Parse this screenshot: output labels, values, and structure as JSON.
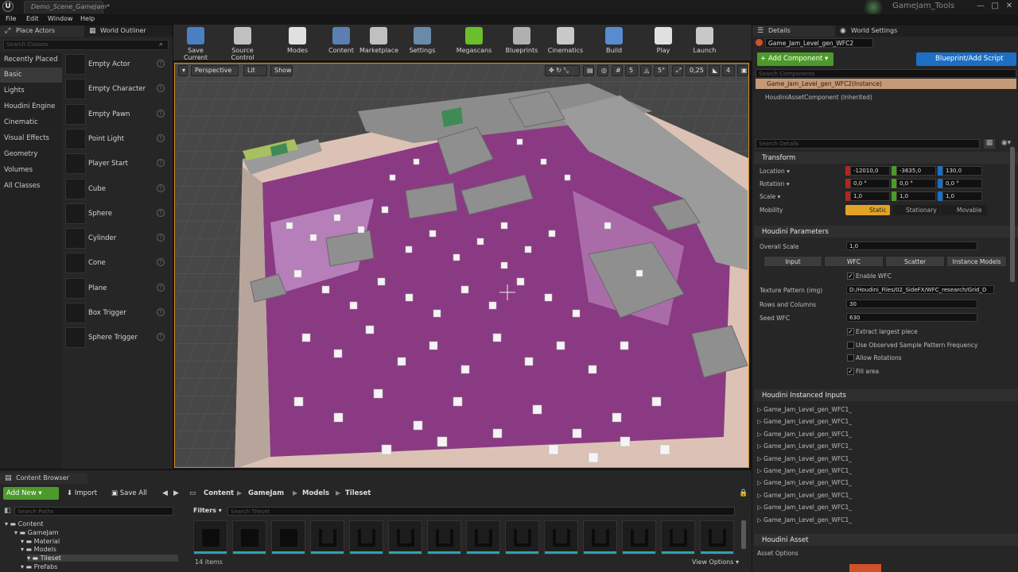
{
  "window": {
    "doc_tab": "Demo_Scene_GameJam*",
    "project_name": "GameJam_Tools",
    "controls": [
      "—",
      "□",
      "✕"
    ]
  },
  "menu": [
    "File",
    "Edit",
    "Window",
    "Help"
  ],
  "left_tabs": {
    "place_actors": "Place Actors",
    "world_outliner": "World Outliner"
  },
  "search_classes_placeholder": "Search Classes",
  "categories": [
    "Recently Placed",
    "Basic",
    "Lights",
    "Houdini Engine",
    "Cinematic",
    "Visual Effects",
    "Geometry",
    "Volumes",
    "All Classes"
  ],
  "selected_category": "Basic",
  "actors": [
    "Empty Actor",
    "Empty Character",
    "Empty Pawn",
    "Point Light",
    "Player Start",
    "Cube",
    "Sphere",
    "Cylinder",
    "Cone",
    "Plane",
    "Box Trigger",
    "Sphere Trigger"
  ],
  "toolbar": [
    {
      "label": "Save Current",
      "icon": "save-icon"
    },
    {
      "label": "Source Control",
      "icon": "source-control-icon"
    },
    {
      "label": "Modes",
      "icon": "modes-icon"
    },
    {
      "label": "Content",
      "icon": "content-icon"
    },
    {
      "label": "Marketplace",
      "icon": "marketplace-icon"
    },
    {
      "label": "Settings",
      "icon": "settings-icon"
    },
    {
      "label": "Megascans",
      "icon": "megascans-icon"
    },
    {
      "label": "Blueprints",
      "icon": "blueprints-icon"
    },
    {
      "label": "Cinematics",
      "icon": "cinematics-icon"
    },
    {
      "label": "Build",
      "icon": "build-icon"
    },
    {
      "label": "Play",
      "icon": "play-icon"
    },
    {
      "label": "Launch",
      "icon": "launch-icon"
    }
  ],
  "viewport": {
    "perspective": "Perspective",
    "lit": "Lit",
    "show": "Show",
    "snap_grid": "5",
    "snap_rot": "5°",
    "snap_scale": "0,25",
    "cam_speed": "4"
  },
  "details": {
    "tab_details": "Details",
    "tab_world": "World Settings",
    "actor_name": "Game_Jam_Level_gen_WFC2",
    "add_component": "+ Add Component ▾",
    "blueprint": "Blueprint/Add Script",
    "search_components": "Search Components",
    "instance_row": "Game_Jam_Level_gen_WFC2(Instance)",
    "component_row": "HoudiniAssetComponent (Inherited)",
    "search_details": "Search Details",
    "transform_header": "Transform",
    "location_label": "Location ▾",
    "location": [
      "-12010,0",
      "-3635,0",
      "130,0"
    ],
    "rotation_label": "Rotation ▾",
    "rotation": [
      "0,0 °",
      "0,0 °",
      "0,0 °"
    ],
    "scale_label": "Scale ▾",
    "scale": [
      "1,0",
      "1,0",
      "1,0"
    ],
    "mobility_label": "Mobility",
    "mobility": [
      "Static",
      "Stationary",
      "Movable"
    ],
    "houdini_params_header": "Houdini Parameters",
    "overall_scale_label": "Overall Scale",
    "overall_scale": "1,0",
    "param_tabs": [
      "Input",
      "WFC",
      "Scatter",
      "Instance Models"
    ],
    "enable_wfc": "Enable WFC",
    "texture_label": "Texture Pattern (img)",
    "texture_value": "D:/Houdini_Files/02_SideFX/WFC_research/Grid_D",
    "rows_label": "Rows and Columns",
    "rows_value": "30",
    "seed_label": "Seed WFC",
    "seed_value": "630",
    "checks": [
      {
        "label": "Extract largest piece",
        "checked": true
      },
      {
        "label": "Use Observed Sample Pattern Frequency",
        "checked": false
      },
      {
        "label": "Allow Rotations",
        "checked": false
      },
      {
        "label": "Fill area",
        "checked": true
      }
    ],
    "instanced_header": "Houdini Instanced Inputs",
    "instanced_inputs": [
      "Game_Jam_Level_gen_WFC1_",
      "Game_Jam_Level_gen_WFC1_",
      "Game_Jam_Level_gen_WFC1_",
      "Game_Jam_Level_gen_WFC1_",
      "Game_Jam_Level_gen_WFC1_",
      "Game_Jam_Level_gen_WFC1_",
      "Game_Jam_Level_gen_WFC1_",
      "Game_Jam_Level_gen_WFC1_",
      "Game_Jam_Level_gen_WFC1_",
      "Game_Jam_Level_gen_WFC1_"
    ],
    "houdini_asset_header": "Houdini Asset",
    "asset_options": "Asset Options"
  },
  "content_browser": {
    "tab": "Content Browser",
    "add_new": "Add New ▾",
    "import": "Import",
    "save_all": "Save All",
    "path": [
      "Content",
      "GameJam",
      "Models",
      "Tileset"
    ],
    "search_paths": "Search Paths",
    "filters": "Filters ▾",
    "search_tileset": "Search Tileset",
    "tree": [
      "Content",
      "GameJam",
      "Material",
      "Models",
      "Tileset",
      "Prefabs"
    ],
    "items_count": "14 items",
    "view_options": "View Options ▾",
    "asset_count_shown": 14
  },
  "colors": {
    "accent_green": "#4c9a2a",
    "accent_blue": "#1d6fc4",
    "selection_orange": "#d08a20",
    "magenta_floor": "#8a3a82"
  }
}
